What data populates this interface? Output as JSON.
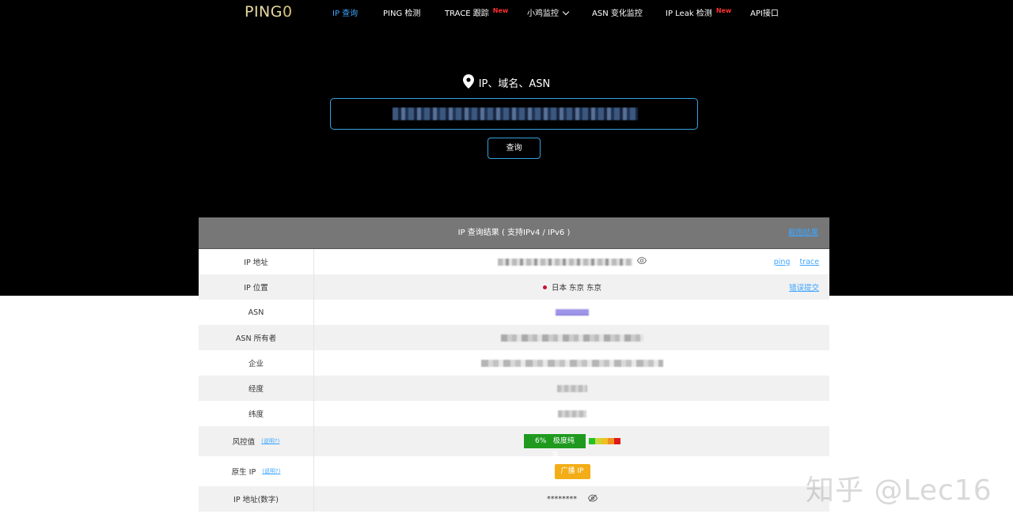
{
  "brand": {
    "logo_text": "PING",
    "logo_accent": "0"
  },
  "nav": {
    "items": [
      {
        "label": "IP 查询",
        "active": true
      },
      {
        "label": "PING 检测"
      },
      {
        "label": "TRACE 跟踪",
        "badge": "New"
      },
      {
        "label": "小鸡监控"
      },
      {
        "label": "ASN 变化监控"
      },
      {
        "label": "IP Leak 检测",
        "badge": "New"
      },
      {
        "label": "API接口"
      }
    ]
  },
  "search": {
    "title": "IP、域名、ASN",
    "input_value": "",
    "button_label": "查询"
  },
  "result": {
    "header": "IP 查询结果 ( 支持IPv4 / IPv6 )",
    "screenshot_link": "截图结果",
    "rows": [
      {
        "label": "IP 地址",
        "links": [
          "ping",
          "trace"
        ]
      },
      {
        "label": "IP 位置",
        "value": "日本 东京 东京",
        "link": "错误提交"
      },
      {
        "label": "ASN"
      },
      {
        "label": "ASN 所有者"
      },
      {
        "label": "企业"
      },
      {
        "label": "经度"
      },
      {
        "label": "纬度"
      },
      {
        "label": "风控值",
        "help": "(说明?)",
        "risk_percent": "6%",
        "risk_text": "极度纯净"
      },
      {
        "label": "原生 IP",
        "help": "(说明?)",
        "badge": "广播 IP"
      },
      {
        "label": "IP 地址(数字)",
        "value": "********"
      }
    ]
  },
  "colors": {
    "accent": "#3ea6ff",
    "risk_green": "#1f9a1f",
    "native_orange": "#f3ad16",
    "header_gray": "#777777"
  },
  "watermark": "知乎 @Lec16"
}
